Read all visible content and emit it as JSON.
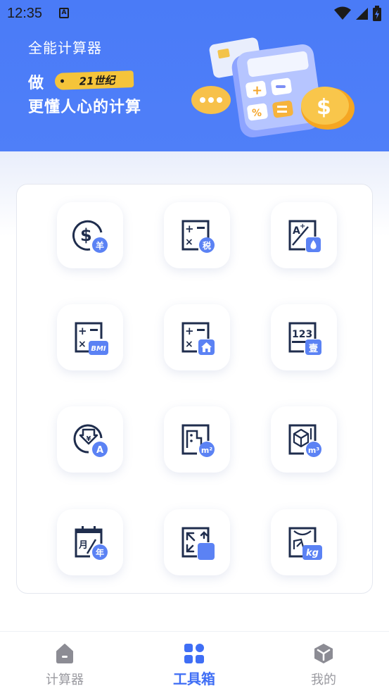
{
  "status_bar": {
    "time": "12:35",
    "notification_icon": "A"
  },
  "banner": {
    "title": "全能计算器",
    "line1_prefix": "做",
    "tag": "21世纪",
    "line2": "更懂人心的计算"
  },
  "tools": [
    {
      "icon": "currency-exchange-icon",
      "badge": "羊"
    },
    {
      "icon": "tax-calculator-icon",
      "badge": "税"
    },
    {
      "icon": "font-size-icon",
      "badge": ""
    },
    {
      "icon": "bmi-calculator-icon",
      "badge": "BMI"
    },
    {
      "icon": "mortgage-calculator-icon",
      "badge": ""
    },
    {
      "icon": "number-uppercase-icon",
      "badge": "壹"
    },
    {
      "icon": "loan-icon",
      "badge": "A"
    },
    {
      "icon": "area-converter-icon",
      "badge": "m²"
    },
    {
      "icon": "volume-converter-icon",
      "badge": "m³"
    },
    {
      "icon": "date-calculator-icon",
      "badge": "年"
    },
    {
      "icon": "unit-converter-icon",
      "badge": ""
    },
    {
      "icon": "weight-converter-icon",
      "badge": "kg"
    }
  ],
  "tabbar": {
    "tabs": [
      {
        "label": "计算器",
        "icon": "home-icon",
        "active": false
      },
      {
        "label": "工具箱",
        "icon": "grid-icon",
        "active": true
      },
      {
        "label": "我的",
        "icon": "cube-icon",
        "active": false
      }
    ]
  },
  "colors": {
    "primary": "#3f6ef5",
    "icon_dark": "#1f2d4d",
    "tab_inactive": "#9a9aa0"
  }
}
